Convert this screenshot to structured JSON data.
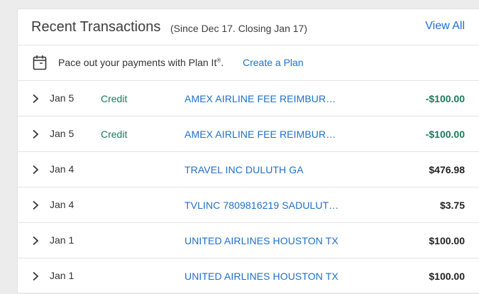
{
  "header": {
    "title": "Recent Transactions",
    "subtitle": "(Since Dec 17. Closing Jan 17)",
    "view_all": "View All"
  },
  "planit": {
    "icon": "calendar-icon",
    "text": "Pace out your payments with Plan It",
    "registered": "®",
    "suffix": ".",
    "link": "Create a Plan"
  },
  "transactions": [
    {
      "date": "Jan 5",
      "type": "Credit",
      "description": "AMEX AIRLINE FEE REIMBUR…",
      "amount": "-$100.00",
      "is_credit": true
    },
    {
      "date": "Jan 5",
      "type": "Credit",
      "description": "AMEX AIRLINE FEE REIMBUR…",
      "amount": "-$100.00",
      "is_credit": true
    },
    {
      "date": "Jan 4",
      "type": "",
      "description": "TRAVEL INC DULUTH GA",
      "amount": "$476.98",
      "is_credit": false
    },
    {
      "date": "Jan 4",
      "type": "",
      "description": "TVLINC 7809816219 SADULUT…",
      "amount": "$3.75",
      "is_credit": false
    },
    {
      "date": "Jan 1",
      "type": "",
      "description": "UNITED AIRLINES HOUSTON TX",
      "amount": "$100.00",
      "is_credit": false
    },
    {
      "date": "Jan 1",
      "type": "",
      "description": "UNITED AIRLINES HOUSTON TX",
      "amount": "$100.00",
      "is_credit": false
    }
  ],
  "colors": {
    "link": "#1f6fc8",
    "credit": "#1b7a5a",
    "text": "#333333"
  }
}
